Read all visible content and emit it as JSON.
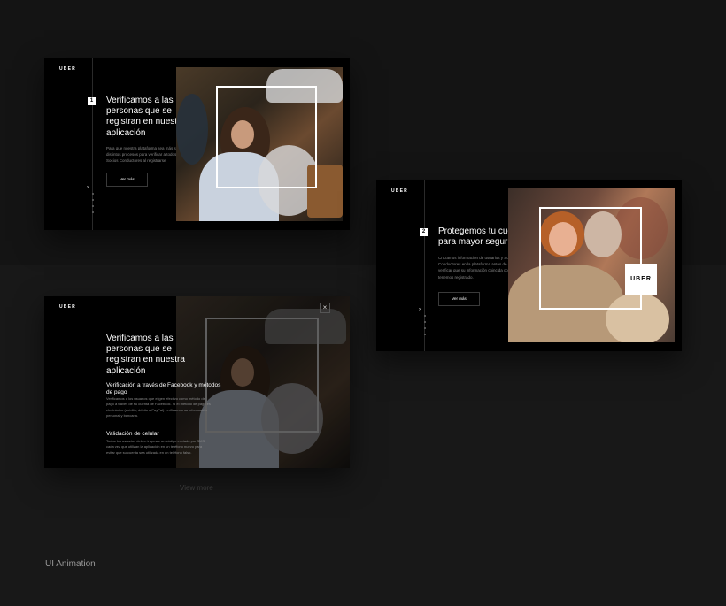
{
  "cards": {
    "card1": {
      "logo": "UBER",
      "step": "1",
      "title": "Verificamos a las personas que se registran en nuestra aplicación",
      "body": "Para que nuestra plataforma sea más segura, usamos distintos procesos para verificar a todos los usuarios y Socios Conductores al registrarse",
      "button": "Ver más",
      "arrow": "›"
    },
    "card2": {
      "logo": "UBER",
      "step": "2",
      "title": "Protegemos tu cuenta para mayor seguridad",
      "body": "Cruzamos información de usuarios y Socios Conductores en la plataforma antes de cada viaje para verificar que su información coincida con el perfil que tenemos registrado.",
      "button": "Ver más",
      "badge": "UBER",
      "arrow": "›"
    },
    "card3": {
      "logo": "UBER",
      "close": "×",
      "title": "Verificamos a las personas que se registran en nuestra aplicación",
      "section1_title": "Verificación a través de Facebook y métodos de pago",
      "section1_body": "Verificamos a los usuarios que eligen efectivo como método de pago a través de su cuenta de Facebook. Si el método de pago es electrónico (crédito, débito o PayPal) verificamos su información personal y bancaria.",
      "section2_title": "Validación de celular",
      "section2_body": "Todos los usuarios deben ingresar un código enviado por SMS cada vez que utilizan la aplicación en un teléfono nuevo para evitar que su cuenta sea utilizada en un teléfono falso."
    }
  },
  "view_more": "View more",
  "caption": "UI Animation",
  "colors": {
    "background": "#141414",
    "card": "#000000",
    "accent": "#ffffff"
  }
}
